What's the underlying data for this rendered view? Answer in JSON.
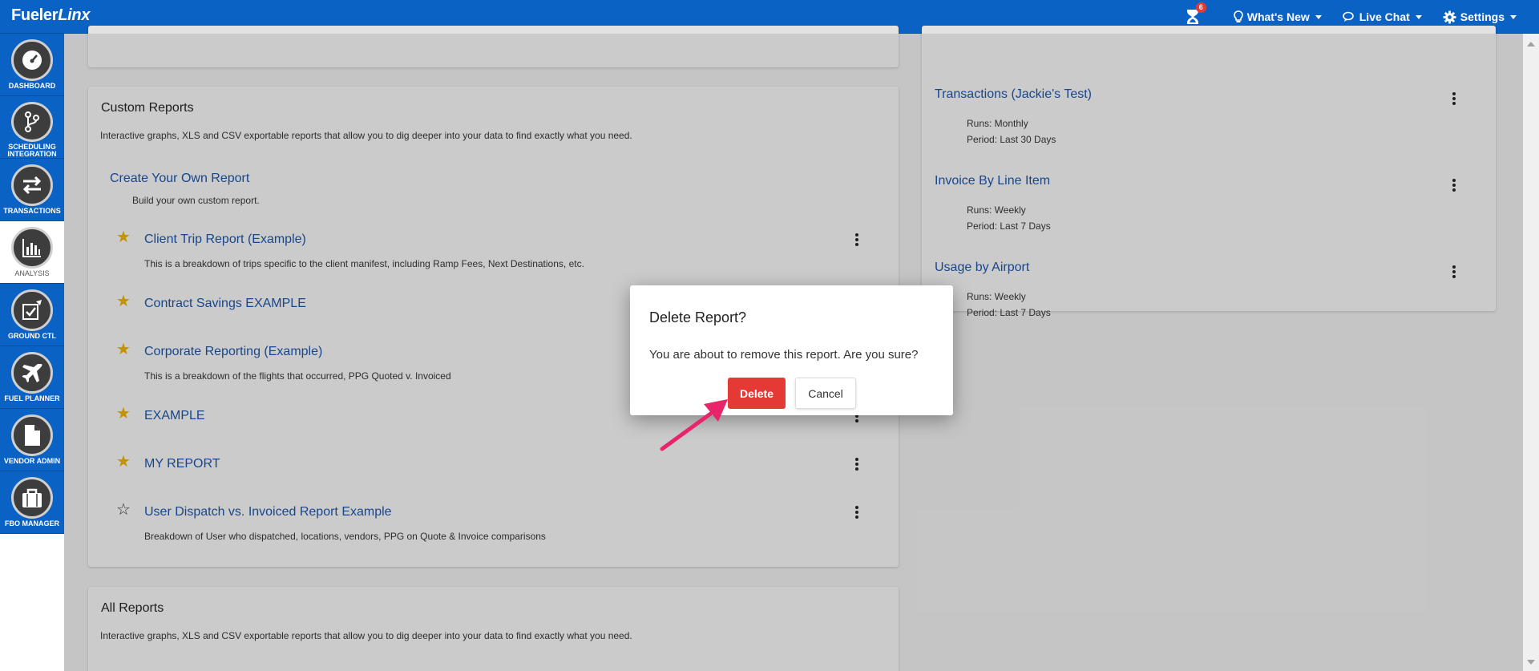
{
  "header": {
    "logo_main": "Fueler",
    "logo_italic": "Linx",
    "notification_count": "6",
    "whats_new": "What's New",
    "live_chat": "Live Chat",
    "settings": "Settings"
  },
  "sidebar": {
    "items": [
      {
        "label1": "DASHBOARD",
        "label2": ""
      },
      {
        "label1": "SCHEDULING",
        "label2": "INTEGRATION"
      },
      {
        "label1": "TRANSACTIONS",
        "label2": ""
      },
      {
        "label1": "ANALYSIS",
        "label2": ""
      },
      {
        "label1": "GROUND CTL",
        "label2": ""
      },
      {
        "label1": "FUEL PLANNER",
        "label2": ""
      },
      {
        "label1": "VENDOR ADMIN",
        "label2": ""
      },
      {
        "label1": "FBO MANAGER",
        "label2": ""
      }
    ]
  },
  "custom_reports": {
    "title": "Custom Reports",
    "description": "Interactive graphs, XLS and CSV exportable reports that allow you to dig deeper into your data to find exactly what you need.",
    "create_link": "Create Your Own Report",
    "create_desc": "Build your own custom report.",
    "reports": [
      {
        "name": "Client Trip Report (Example)",
        "desc": "This is a breakdown of trips specific to the client manifest, including Ramp Fees, Next Destinations, etc."
      },
      {
        "name": "Contract Savings EXAMPLE",
        "desc": ""
      },
      {
        "name": "Corporate Reporting (Example)",
        "desc": "This is a breakdown of the flights that occurred, PPG Quoted v. Invoiced"
      },
      {
        "name": "EXAMPLE",
        "desc": ""
      },
      {
        "name": "MY REPORT",
        "desc": ""
      },
      {
        "name": "User Dispatch vs. Invoiced Report Example",
        "desc": "Breakdown of User who dispatched, locations, vendors, PPG on Quote & Invoice comparisons"
      }
    ]
  },
  "scheduled_reports": [
    {
      "name": "Transactions (Jackie's Test)",
      "runs": "Runs: Monthly",
      "period": "Period: Last 30 Days"
    },
    {
      "name": "Invoice By Line Item",
      "runs": "Runs: Weekly",
      "period": "Period: Last 7 Days"
    },
    {
      "name": "Usage by Airport",
      "runs": "Runs: Weekly",
      "period": "Period: Last 7 Days"
    }
  ],
  "all_reports": {
    "title": "All Reports",
    "description": "Interactive graphs, XLS and CSV exportable reports that allow you to dig deeper into your data to find exactly what you need."
  },
  "modal": {
    "title": "Delete Report?",
    "message": "You are about to remove this report. Are you sure?",
    "delete_label": "Delete",
    "cancel_label": "Cancel"
  },
  "colors": {
    "brand": "#0b62c5",
    "danger": "#e53935",
    "star": "#d8a300",
    "arrow": "#e8246b"
  }
}
